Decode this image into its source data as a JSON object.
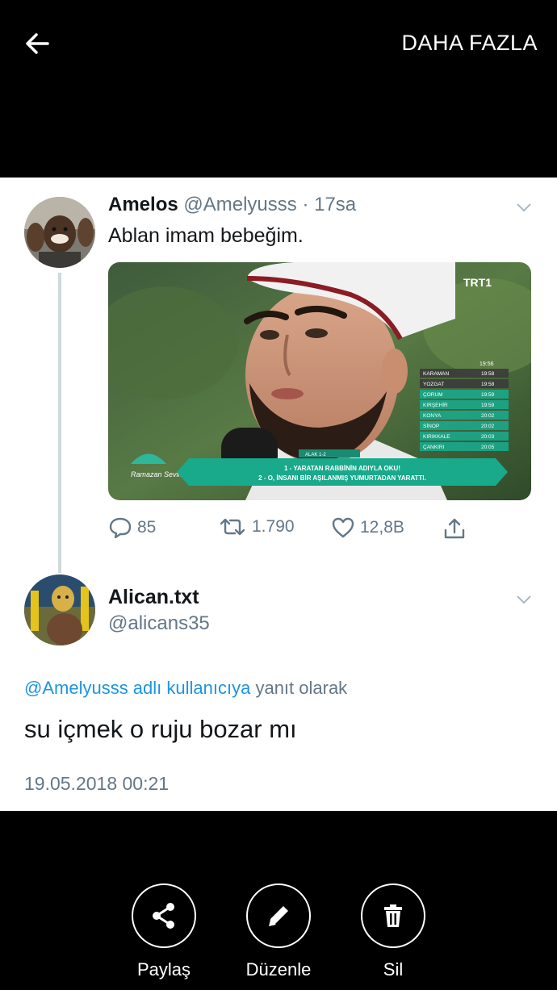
{
  "topbar": {
    "back_icon": "arrow-left-icon",
    "more_label": "DAHA FAZLA"
  },
  "tweet1": {
    "name": "Amelos",
    "handle": "@Amelyusss",
    "separator": "·",
    "time": "17sa",
    "text": "Ablan imam bebeğim.",
    "media": {
      "channel_logo": "TRT1",
      "program_logo": "Ramazan Sevinci",
      "verse_ref": "ALAK 1-2",
      "verse_lines": [
        "1 - YARATAN RABBİNİN ADIYLA OKU!",
        "2 - O, İNSANI BİR AŞILANMIŞ YUMURTADAN YARATTI."
      ],
      "times_header": "19:56",
      "times": [
        {
          "city": "KARAMAN",
          "time": "19:58"
        },
        {
          "city": "YOZGAT",
          "time": "19:58"
        },
        {
          "city": "ÇORUM",
          "time": "19:59"
        },
        {
          "city": "KIRŞEHİR",
          "time": "19:59"
        },
        {
          "city": "KONYA",
          "time": "20:02"
        },
        {
          "city": "SİNOP",
          "time": "20:02"
        },
        {
          "city": "KIRIKKALE",
          "time": "20:03"
        },
        {
          "city": "ÇANKIRI",
          "time": "20:05"
        }
      ]
    },
    "actions": {
      "replies": "85",
      "retweets": "1.790",
      "likes": "12,8B"
    }
  },
  "tweet2": {
    "name": "Alican.txt",
    "handle": "@alicans35",
    "reply_to_handle": "@Amelyusss adlı kullanıcıya",
    "reply_to_suffix": "yanıt olarak",
    "text": "su içmek o ruju bozar mı",
    "timestamp": "19.05.2018 00:21"
  },
  "bottom_actions": [
    {
      "label": "Paylaş",
      "icon": "share-icon"
    },
    {
      "label": "Düzenle",
      "icon": "pencil-icon"
    },
    {
      "label": "Sil",
      "icon": "trash-icon"
    }
  ],
  "colors": {
    "background": "#000000",
    "card": "#ffffff",
    "link": "#1b95e0",
    "secondary_text": "#657786",
    "primary_text": "#14171a",
    "overlay_teal": "#19a98b"
  }
}
